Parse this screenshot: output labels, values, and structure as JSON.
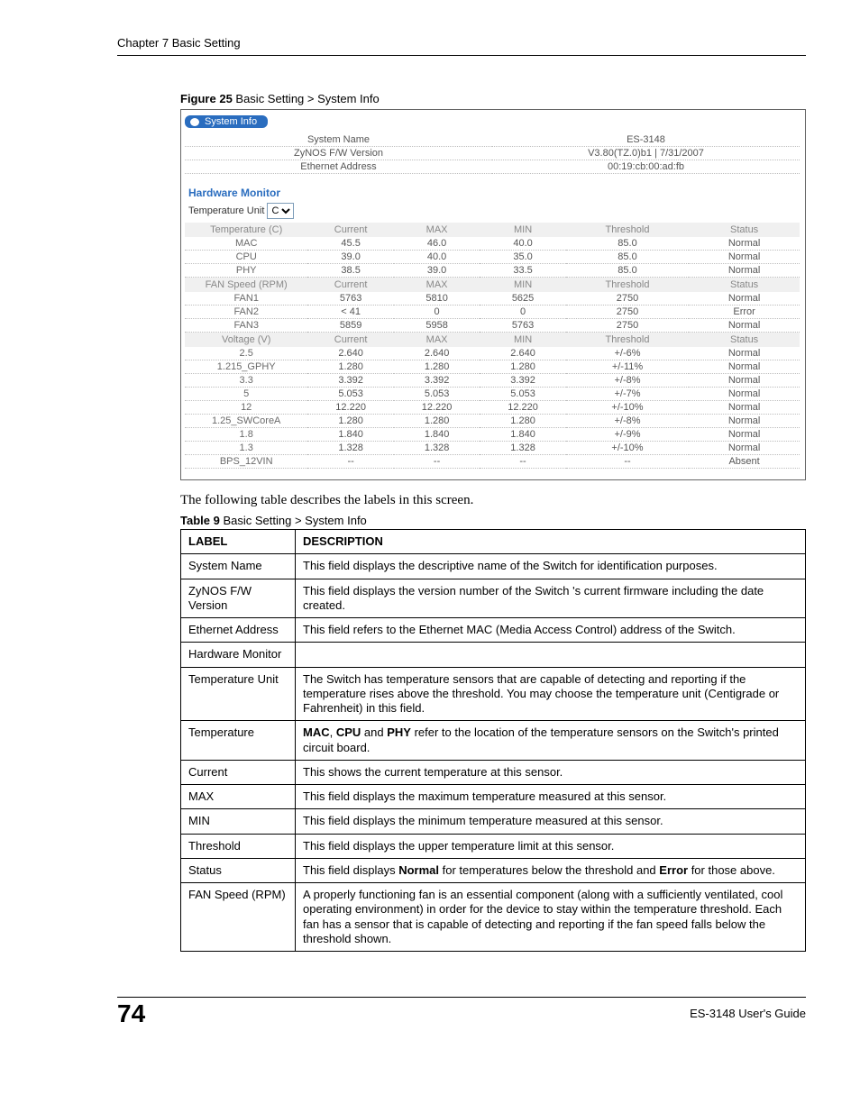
{
  "chapter_head": "Chapter 7 Basic Setting",
  "figure": {
    "prefix": "Figure 25",
    "suffix": "   Basic Setting > System Info"
  },
  "tab_title": "System Info",
  "sysinfo": [
    {
      "label": "System Name",
      "value": "ES-3148"
    },
    {
      "label": "ZyNOS F/W Version",
      "value": "V3.80(TZ.0)b1 | 7/31/2007"
    },
    {
      "label": "Ethernet Address",
      "value": "00:19:cb:00:ad:fb"
    }
  ],
  "hw_monitor_title": "Hardware Monitor",
  "temp_unit_label": "Temperature Unit",
  "temp_unit_value": "C",
  "temp_header": {
    "c1": "Temperature (C)",
    "c2": "Current",
    "c3": "MAX",
    "c4": "MIN",
    "c5": "Threshold",
    "c6": "Status"
  },
  "temp_rows": [
    {
      "name": "MAC",
      "current": "45.5",
      "max": "46.0",
      "min": "40.0",
      "thr": "85.0",
      "status": "Normal"
    },
    {
      "name": "CPU",
      "current": "39.0",
      "max": "40.0",
      "min": "35.0",
      "thr": "85.0",
      "status": "Normal"
    },
    {
      "name": "PHY",
      "current": "38.5",
      "max": "39.0",
      "min": "33.5",
      "thr": "85.0",
      "status": "Normal"
    }
  ],
  "fan_header": {
    "c1": "FAN Speed (RPM)",
    "c2": "Current",
    "c3": "MAX",
    "c4": "MIN",
    "c5": "Threshold",
    "c6": "Status"
  },
  "fan_rows": [
    {
      "name": "FAN1",
      "current": "5763",
      "max": "5810",
      "min": "5625",
      "thr": "2750",
      "status": "Normal"
    },
    {
      "name": "FAN2",
      "current": "< 41",
      "max": "0",
      "min": "0",
      "thr": "2750",
      "status": "Error"
    },
    {
      "name": "FAN3",
      "current": "5859",
      "max": "5958",
      "min": "5763",
      "thr": "2750",
      "status": "Normal"
    }
  ],
  "volt_header": {
    "c1": "Voltage (V)",
    "c2": "Current",
    "c3": "MAX",
    "c4": "MIN",
    "c5": "Threshold",
    "c6": "Status"
  },
  "volt_rows": [
    {
      "name": "2.5",
      "current": "2.640",
      "max": "2.640",
      "min": "2.640",
      "thr": "+/-6%",
      "status": "Normal"
    },
    {
      "name": "1.215_GPHY",
      "current": "1.280",
      "max": "1.280",
      "min": "1.280",
      "thr": "+/-11%",
      "status": "Normal"
    },
    {
      "name": "3.3",
      "current": "3.392",
      "max": "3.392",
      "min": "3.392",
      "thr": "+/-8%",
      "status": "Normal"
    },
    {
      "name": "5",
      "current": "5.053",
      "max": "5.053",
      "min": "5.053",
      "thr": "+/-7%",
      "status": "Normal"
    },
    {
      "name": "12",
      "current": "12.220",
      "max": "12.220",
      "min": "12.220",
      "thr": "+/-10%",
      "status": "Normal"
    },
    {
      "name": "1.25_SWCoreA",
      "current": "1.280",
      "max": "1.280",
      "min": "1.280",
      "thr": "+/-8%",
      "status": "Normal"
    },
    {
      "name": "1.8",
      "current": "1.840",
      "max": "1.840",
      "min": "1.840",
      "thr": "+/-9%",
      "status": "Normal"
    },
    {
      "name": "1.3",
      "current": "1.328",
      "max": "1.328",
      "min": "1.328",
      "thr": "+/-10%",
      "status": "Normal"
    },
    {
      "name": "BPS_12VIN",
      "current": "--",
      "max": "--",
      "min": "--",
      "thr": "--",
      "status": "Absent"
    }
  ],
  "intro_text": "The following table describes the labels in this screen.",
  "table_caption": {
    "prefix": "Table 9",
    "suffix": "   Basic Setting > System Info"
  },
  "desc_header": {
    "label": "LABEL",
    "desc": "DESCRIPTION"
  },
  "desc_rows": [
    {
      "label": "System Name",
      "desc": "This field displays the descriptive name of the Switch for identification purposes."
    },
    {
      "label": "ZyNOS F/W Version",
      "desc": "This field displays the version number of the Switch 's current firmware including the date created."
    },
    {
      "label": "Ethernet Address",
      "desc": "This field refers to the Ethernet MAC (Media Access Control) address of the Switch."
    },
    {
      "label": "Hardware Monitor",
      "desc": ""
    },
    {
      "label": "Temperature Unit",
      "desc": "The Switch has temperature sensors that are capable of detecting and reporting if the temperature rises above the threshold. You may choose the temperature unit (Centigrade or Fahrenheit) in this field."
    },
    {
      "label": "Temperature",
      "desc_html": "<b>MAC</b>, <b>CPU</b> and <b>PHY</b> refer to the location of the temperature sensors on the Switch's printed circuit board."
    },
    {
      "label": "Current",
      "desc": "This shows the current temperature at this sensor."
    },
    {
      "label": "MAX",
      "desc": "This field displays the maximum temperature measured at this sensor."
    },
    {
      "label": "MIN",
      "desc": "This field displays the minimum temperature measured at this sensor."
    },
    {
      "label": "Threshold",
      "desc": "This field displays the upper temperature limit at this sensor."
    },
    {
      "label": "Status",
      "desc_html": "This field displays <b>Normal</b> for temperatures below the threshold and <b>Error</b> for those above."
    },
    {
      "label": "FAN Speed (RPM)",
      "desc": "A properly functioning fan is an essential component (along with a sufficiently ventilated, cool operating environment) in order for the device to stay within the temperature threshold. Each fan has a sensor that is capable of detecting and reporting if the fan speed falls below the threshold shown."
    }
  ],
  "footer": {
    "page": "74",
    "guide": "ES-3148 User's Guide"
  }
}
